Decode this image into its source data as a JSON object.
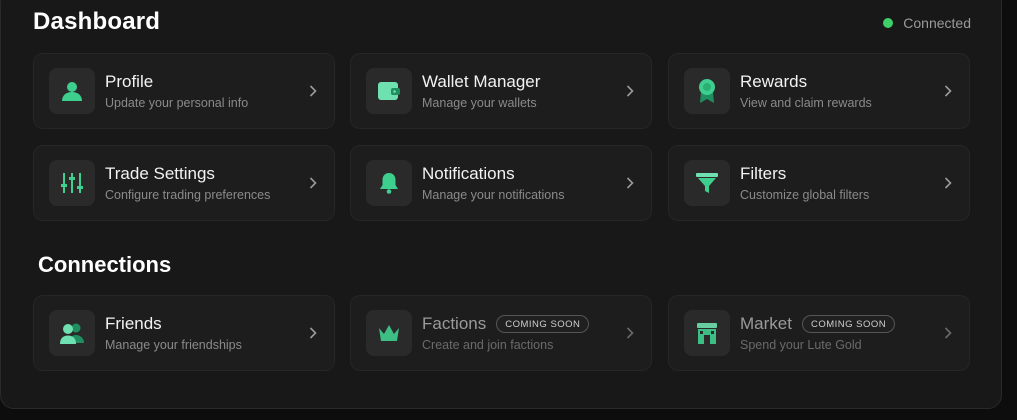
{
  "header": {
    "title": "Dashboard",
    "status_text": "Connected",
    "status_color": "#3ecf6a"
  },
  "dashboard_cards": [
    {
      "name": "Profile",
      "desc": "Update your personal info",
      "icon": "user-icon"
    },
    {
      "name": "Wallet Manager",
      "desc": "Manage your wallets",
      "icon": "wallet-icon"
    },
    {
      "name": "Rewards",
      "desc": "View and claim rewards",
      "icon": "medal-icon"
    },
    {
      "name": "Trade Settings",
      "desc": "Configure trading preferences",
      "icon": "sliders-icon"
    },
    {
      "name": "Notifications",
      "desc": "Manage your notifications",
      "icon": "bell-icon"
    },
    {
      "name": "Filters",
      "desc": "Customize global filters",
      "icon": "funnel-icon"
    }
  ],
  "connections": {
    "title": "Connections",
    "cards": [
      {
        "name": "Friends",
        "desc": "Manage your friendships",
        "icon": "friends-icon"
      },
      {
        "name": "Factions",
        "desc": "Create and join factions",
        "badge": "COMING SOON",
        "icon": "crown-icon"
      },
      {
        "name": "Market",
        "desc": "Spend your Lute Gold",
        "badge": "COMING SOON",
        "icon": "store-icon"
      }
    ]
  },
  "accent_color": "#3ecf8e"
}
